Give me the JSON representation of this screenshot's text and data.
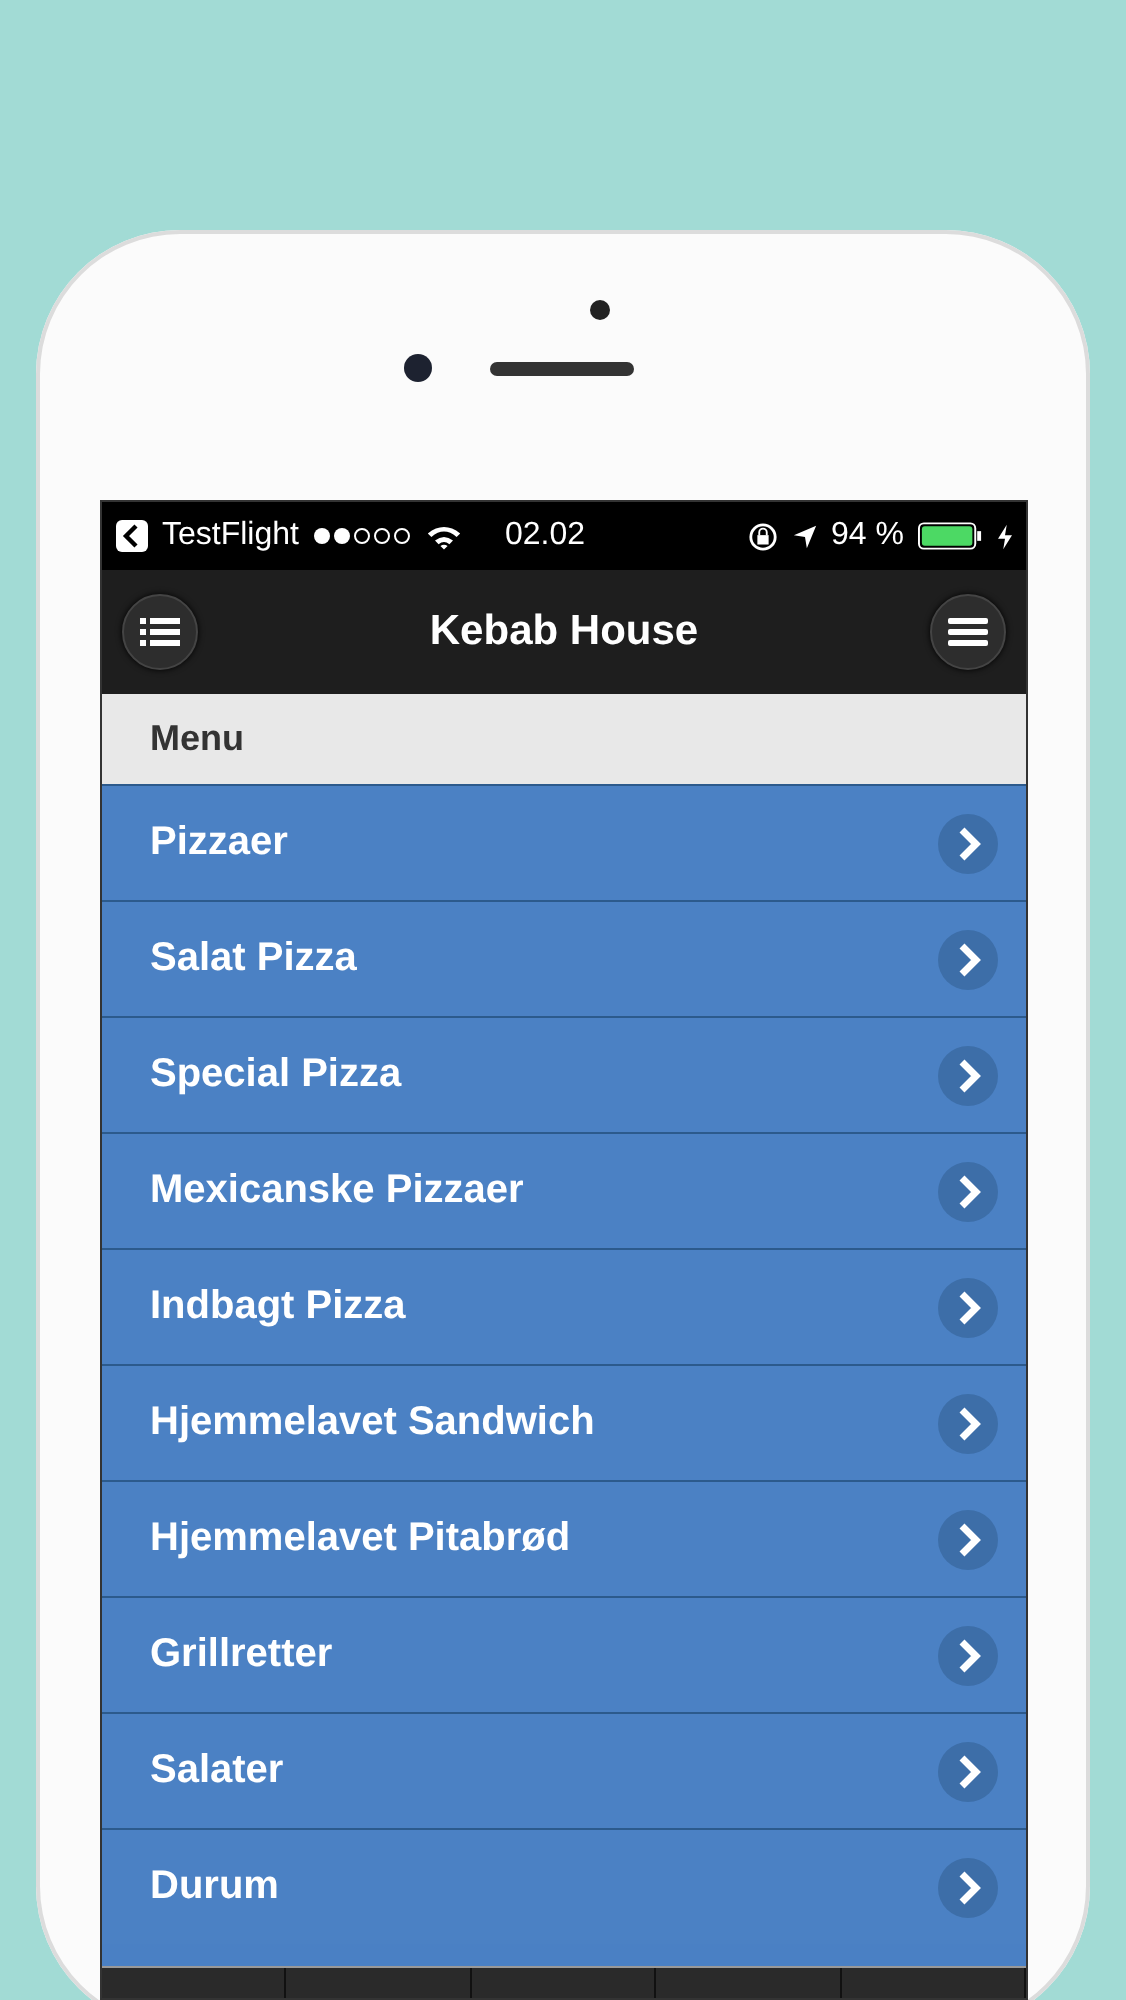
{
  "status_bar": {
    "back_app": "TestFlight",
    "time": "02.02",
    "battery": "94 %"
  },
  "header": {
    "title": "Kebab House"
  },
  "section": {
    "title": "Menu"
  },
  "items": [
    {
      "label": "Pizzaer"
    },
    {
      "label": "Salat Pizza"
    },
    {
      "label": "Special Pizza"
    },
    {
      "label": "Mexicanske Pizzaer"
    },
    {
      "label": "Indbagt Pizza"
    },
    {
      "label": "Hjemmelavet Sandwich"
    },
    {
      "label": "Hjemmelavet Pitabrød"
    },
    {
      "label": "Grillretter"
    },
    {
      "label": "Salater"
    },
    {
      "label": "Durum"
    }
  ]
}
